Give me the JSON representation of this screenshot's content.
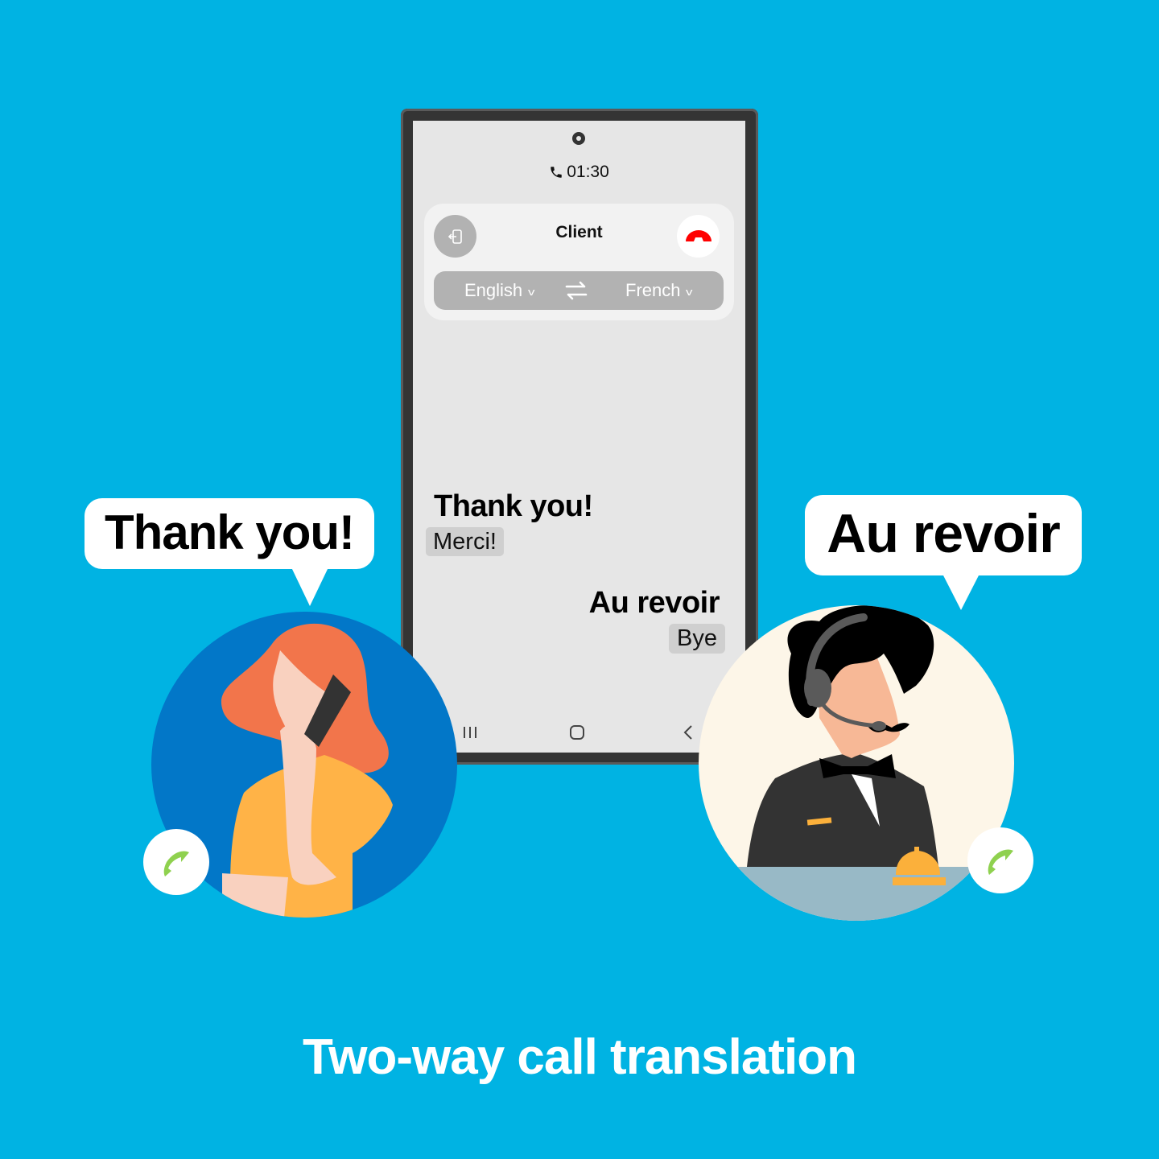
{
  "phone": {
    "call_timer": "01:30",
    "call_icon": "phone-icon",
    "contact_name": "Client",
    "exit_icon": "exit-icon",
    "end_call_icon": "end-call-icon",
    "end_call_color": "#ff0000",
    "source_language": "English",
    "target_language": "French",
    "swap_icon": "swap-arrows-icon",
    "dropdown_icon": "chevron-down-icon",
    "chevron_glyph": "v",
    "messages": [
      {
        "original": "Thank you!",
        "translation": "Merci!",
        "side": "left"
      },
      {
        "original": "Au revoir",
        "translation": "Bye",
        "side": "right"
      }
    ],
    "nav": {
      "recent_icon": "recent-apps-icon",
      "home_icon": "home-icon",
      "back_icon": "back-icon"
    }
  },
  "bubbles": {
    "left_text": "Thank you!",
    "right_text": "Au revoir"
  },
  "characters": {
    "left": "woman-on-phone",
    "right": "concierge-with-headset"
  },
  "badges": {
    "icon": "incoming-call-icon",
    "color": "#8fd14f"
  },
  "caption": "Two-way call translation",
  "colors": {
    "background": "#00b3e3",
    "left_circle": "#0277c8",
    "right_circle": "#fdf6e8"
  }
}
